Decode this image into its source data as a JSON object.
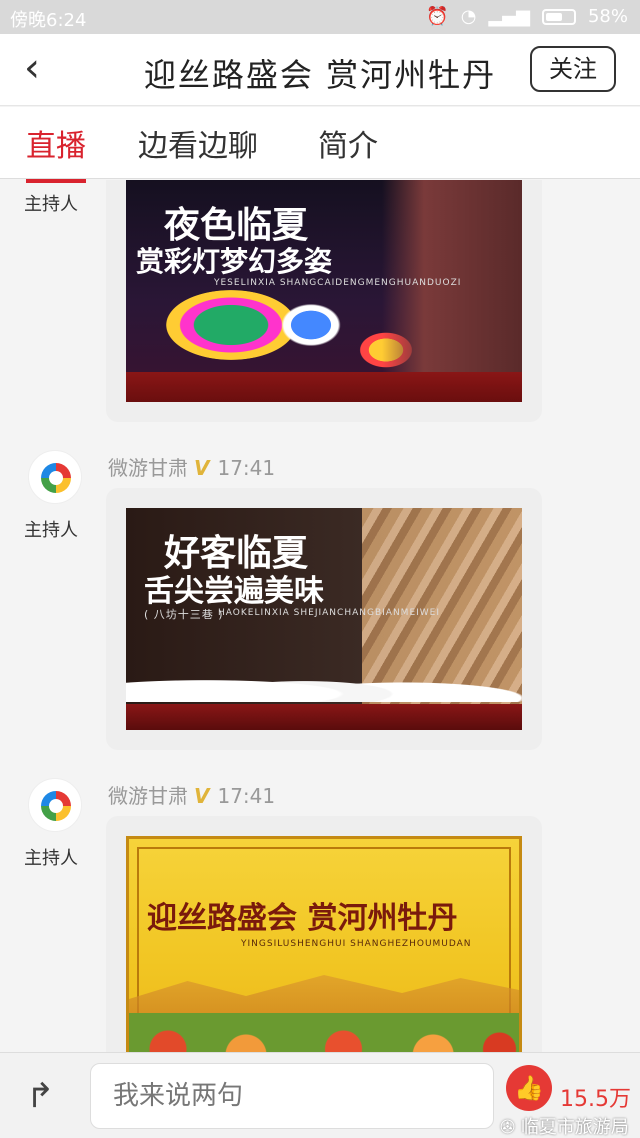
{
  "status_bar": {
    "time": "傍晚6:24",
    "battery": "58%"
  },
  "header": {
    "title": "迎丝路盛会 赏河州牡丹",
    "follow_label": "关注",
    "back_icon": "chevron-left-icon"
  },
  "tabs": [
    {
      "label": "直播",
      "active": true
    },
    {
      "label": "边看边聊"
    },
    {
      "label": "简介"
    }
  ],
  "posts": [
    {
      "host_label": "主持人",
      "banner": {
        "title": "夜色临夏",
        "subtitle": "赏彩灯梦幻多姿",
        "pinyin": "YESELINXIA SHANGCAIDENGMENGHUANDUOZI"
      }
    },
    {
      "author": "微游甘肃",
      "verified": "V",
      "time": "17:41",
      "host_label": "主持人",
      "banner": {
        "title": "好客临夏",
        "subtitle": "舌尖尝遍美味",
        "note": "( 八坊十三巷 )",
        "pinyin": "HAOKELINXIA SHEJIANCHANGBIANMEIWEI"
      }
    },
    {
      "author": "微游甘肃",
      "verified": "V",
      "time": "17:41",
      "host_label": "主持人",
      "banner": {
        "title": "迎丝路盛会  赏河州牡丹",
        "pinyin": "YINGSILUSHENGHUI SHANGHEZHOUMUDAN"
      }
    }
  ],
  "bottom_bar": {
    "comment_placeholder": "我来说两句",
    "like_count": "15.5万",
    "watermark": "临夏市旅游局"
  },
  "colors": {
    "accent": "#d9232e",
    "verified": "#e0b43a"
  }
}
